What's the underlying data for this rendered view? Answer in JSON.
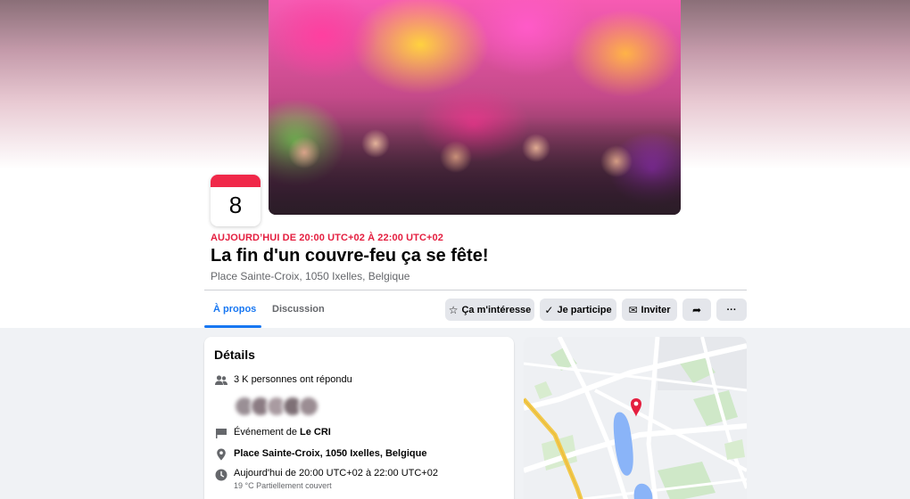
{
  "event": {
    "day": "8",
    "time": "AUJOURD’HUI DE 20:00 UTC+02 À 22:00 UTC+02",
    "title": "La fin d'un couvre-feu ça se fête!",
    "location": "Place Sainte-Croix, 1050 Ixelles, Belgique"
  },
  "tabs": [
    {
      "label": "À propos",
      "active": true
    },
    {
      "label": "Discussion",
      "active": false
    }
  ],
  "actions": {
    "interested": "Ça m'intéresse",
    "going": "Je participe",
    "invite": "Inviter",
    "more": "···"
  },
  "details": {
    "title": "Détails",
    "responded": "3 K personnes ont répondu",
    "organizer_prefix": "Événement de ",
    "organizer": "Le CRI",
    "address": "Place Sainte-Croix, 1050 Ixelles, Belgique",
    "datetime": "Aujourd'hui de 20:00 UTC+02 à 22:00 UTC+02",
    "weather": "19 °C Partiellement couvert"
  },
  "map": {
    "info": "i",
    "marker_color": "#e41e3f"
  },
  "colors": {
    "accent": "#1877f2",
    "date_red": "#e41e3f"
  }
}
